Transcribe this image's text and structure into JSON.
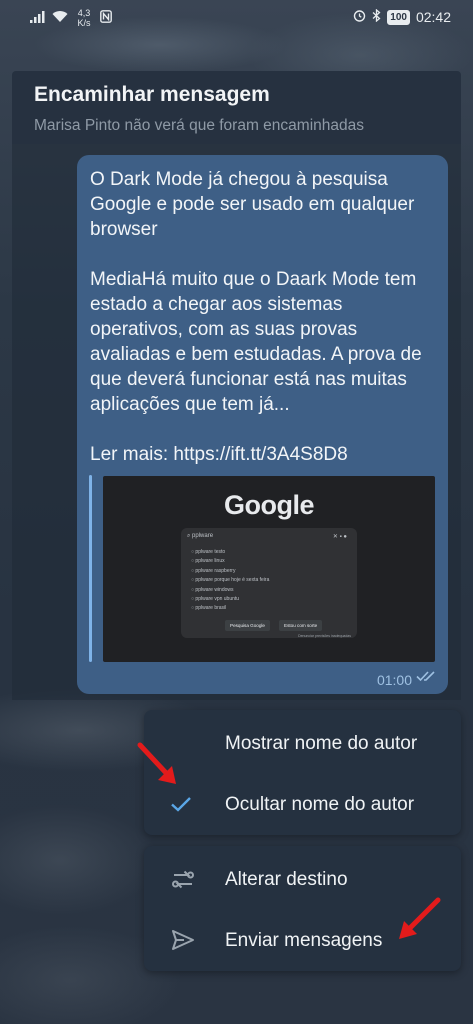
{
  "status_bar": {
    "speed_value": "4,3",
    "speed_unit": "K/s",
    "battery": "100",
    "time": "02:42"
  },
  "header": {
    "title": "Encaminhar mensagem",
    "subtitle": "Marisa Pinto não verá que foram encaminhadas"
  },
  "message": {
    "text": "O Dark Mode já chegou à pesquisa Google e pode ser usado em qualquer browser\n\nMediaHá muito que o Daark Mode tem estado a chegar aos sistemas operativos, com as suas provas avaliadas e bem estudadas. A prova de que deverá funcionar está nas muitas aplicações que tem já...\n\nLer mais: https://ift.tt/3A4S8D8",
    "time": "01:00",
    "preview": {
      "logo": "Google",
      "search_query": "pplware",
      "suggestions": [
        "pplware testo",
        "pplware linux",
        "pplware raspberry",
        "pplware porque hoje é sexta feira",
        "pplware windows",
        "pplware vpn ubuntu",
        "pplware brasil"
      ],
      "btn_search": "Pesquisa Google",
      "btn_lucky": "Estou com sorte",
      "footer_note": "Denunciar previsões inadequadas"
    }
  },
  "menu1": {
    "show_author": "Mostrar nome do autor",
    "hide_author": "Ocultar nome do autor"
  },
  "menu2": {
    "change_dest": "Alterar destino",
    "send": "Enviar mensagens"
  },
  "colors": {
    "accent": "#5aa6e6",
    "arrow": "#e31b1b",
    "bubble": "#3e5f86"
  }
}
